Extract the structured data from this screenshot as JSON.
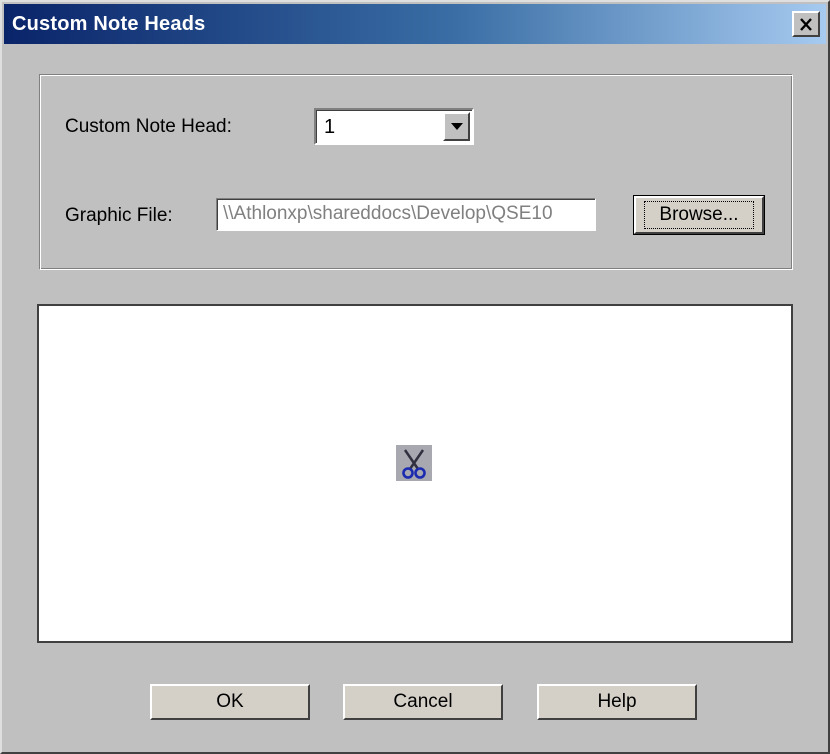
{
  "window": {
    "title": "Custom Note Heads",
    "close_icon": "close-icon"
  },
  "note_head": {
    "label": "Custom Note Head:",
    "selected_value": "1"
  },
  "graphic_file": {
    "label": "Graphic File:",
    "value": "\\\\Athlonxp\\shareddocs\\Develop\\QSE10",
    "browse_label": "Browse..."
  },
  "preview": {
    "icon": "scissors-icon"
  },
  "buttons": {
    "ok": "OK",
    "cancel": "Cancel",
    "help": "Help"
  },
  "colors": {
    "title_start": "#0a246a",
    "title_end": "#a6caf0",
    "face": "#c0c0c0"
  }
}
